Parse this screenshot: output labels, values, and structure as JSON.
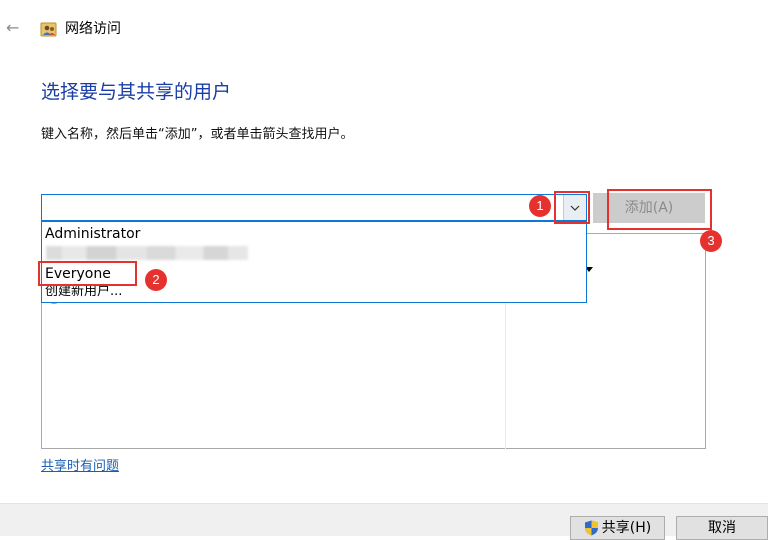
{
  "window": {
    "title": "网络访问",
    "back_icon": "back-arrow-icon",
    "app_icon": "network-users-icon"
  },
  "main": {
    "heading": "选择要与其共享的用户",
    "instruction": "键入名称，然后单击“添加”，或者单击箭头查找用户。",
    "name_input": {
      "value": "",
      "placeholder": ""
    },
    "add_button_label": "添加(A)",
    "dropdown_items": [
      "Administrator",
      "Everyone",
      "创建新用户..."
    ],
    "help_link": "共享时有问题"
  },
  "annotations": {
    "badge1": "1",
    "badge2": "2",
    "badge3": "3",
    "color": "#e5322e"
  },
  "footer": {
    "share_label": "共享(H)",
    "cancel_label": "取消"
  },
  "colors": {
    "heading": "#1a3ea6",
    "link": "#1a5fb4",
    "focus_border": "#0f78d7",
    "disabled_button": "#cccccc"
  }
}
